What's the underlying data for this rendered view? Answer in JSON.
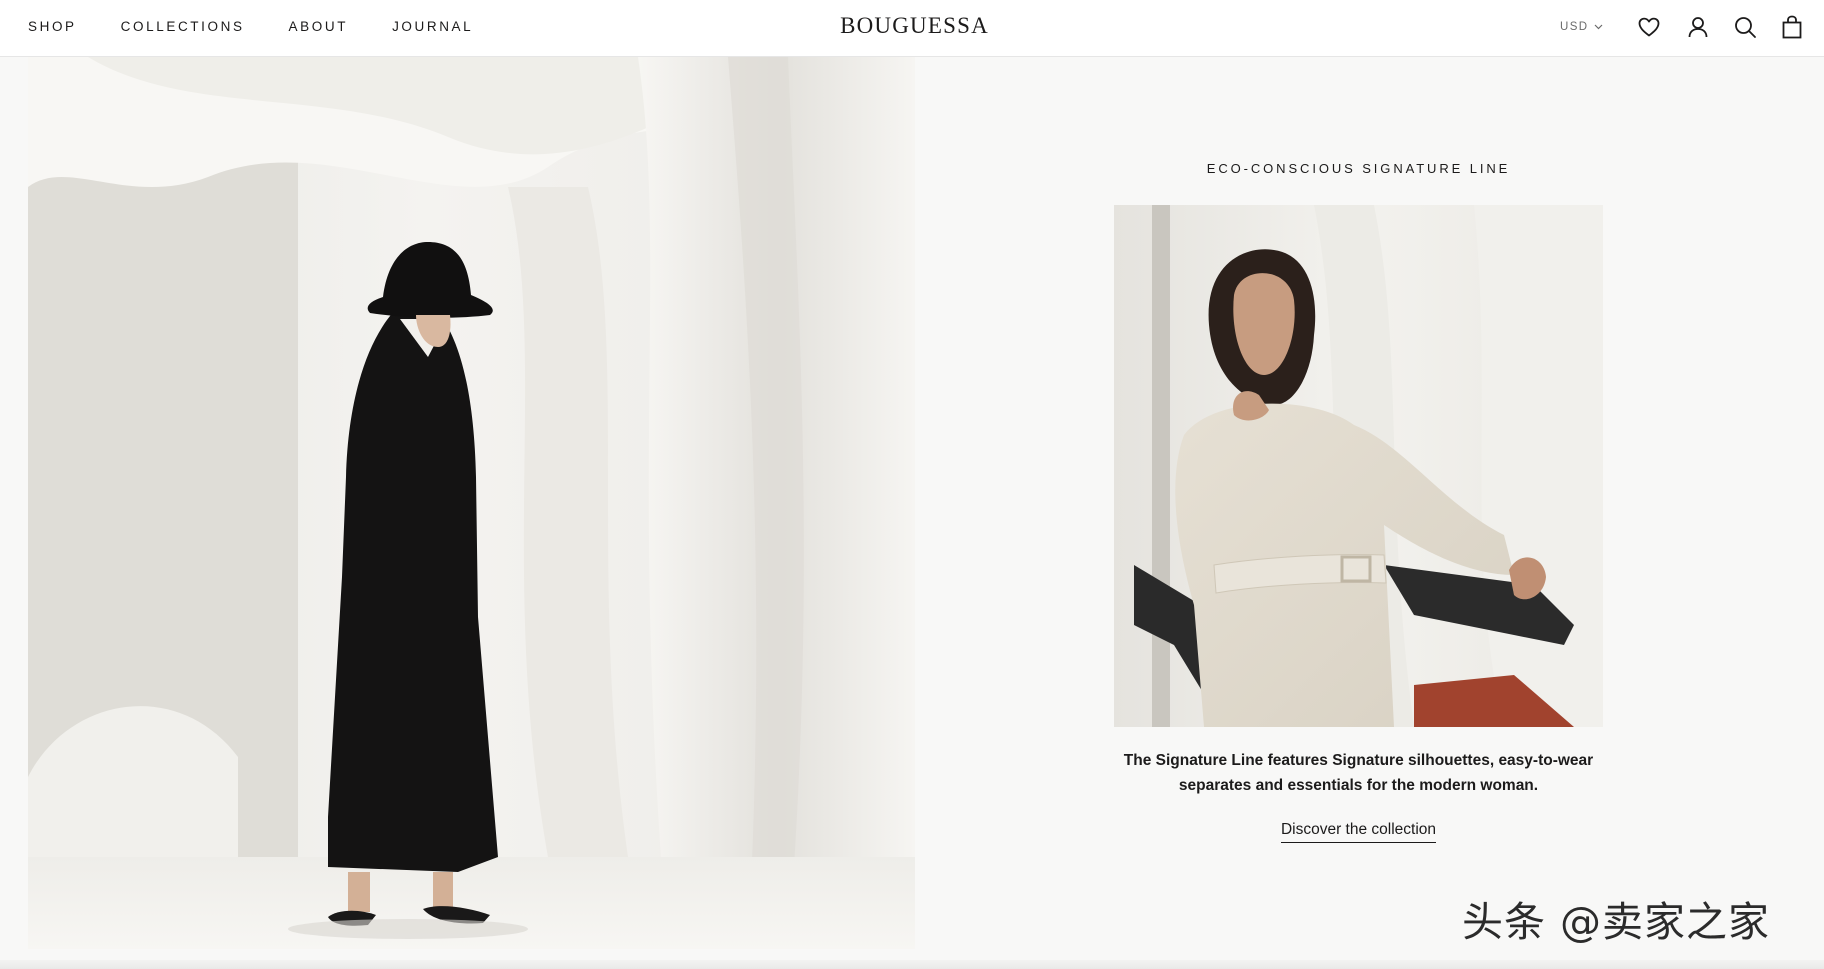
{
  "header": {
    "nav": [
      "SHOP",
      "COLLECTIONS",
      "ABOUT",
      "JOURNAL"
    ],
    "logo": "BOUGUESSA",
    "currency": "USD",
    "icons": [
      "heart-icon",
      "account-icon",
      "search-icon",
      "bag-icon"
    ]
  },
  "hero": {
    "image": "model-in-black-coat-and-bucket-hat-photo"
  },
  "feature": {
    "eyebrow": "ECO-CONSCIOUS SIGNATURE LINE",
    "image": "model-in-beige-belted-shirt-dress-seated-photo",
    "description": "The Signature Line features Signature silhouettes, easy-to-wear separates and essentials for the modern woman.",
    "cta": "Discover the collection"
  },
  "watermark": "头条 @卖家之家",
  "colors": {
    "text": "#1c1b1b",
    "page_background": "#f8f8f7",
    "header_background": "#ffffff",
    "muted": "#6b6b6b"
  }
}
